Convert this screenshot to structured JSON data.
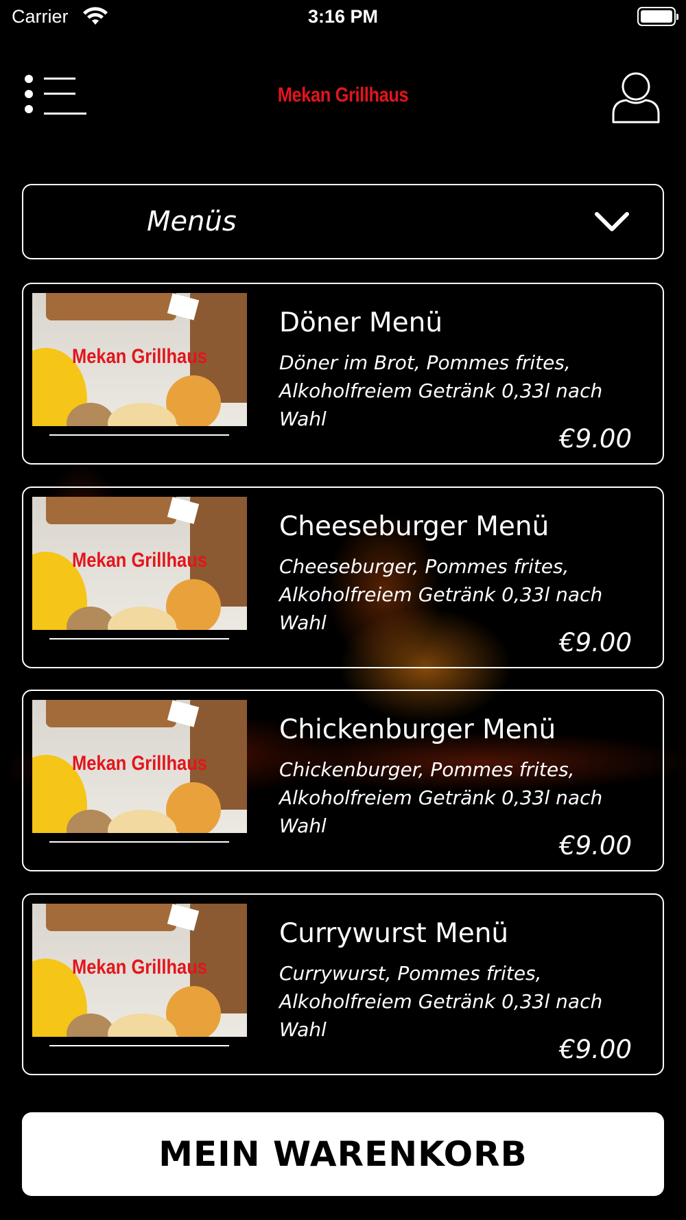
{
  "status_bar": {
    "carrier": "Carrier",
    "time": "3:16 PM"
  },
  "header": {
    "title": "Mekan Grillhaus"
  },
  "category": {
    "selected": "Menüs"
  },
  "items": [
    {
      "thumb_brand": "Mekan Grillhaus",
      "title": "Döner Menü",
      "description": "Döner im Brot, Pommes frites,\nAlkoholfreiem Getränk 0,33l nach Wahl",
      "price": "€9.00"
    },
    {
      "thumb_brand": "Mekan Grillhaus",
      "title": "Cheeseburger Menü",
      "description": "Cheeseburger, Pommes frites,\nAlkoholfreiem Getränk 0,33l nach Wahl",
      "price": "€9.00"
    },
    {
      "thumb_brand": "Mekan Grillhaus",
      "title": "Chickenburger Menü",
      "description": "Chickenburger, Pommes frites,\nAlkoholfreiem Getränk 0,33l nach Wahl",
      "price": "€9.00"
    },
    {
      "thumb_brand": "Mekan Grillhaus",
      "title": "Currywurst Menü",
      "description": "Currywurst, Pommes frites,\nAlkoholfreiem Getränk 0,33l nach Wahl",
      "price": "€9.00"
    }
  ],
  "cart": {
    "label": "MEIN WARENKORB"
  },
  "colors": {
    "brand_red": "#e3151c",
    "background": "#000000",
    "foreground": "#ffffff"
  },
  "icons": [
    "wifi-icon",
    "battery-icon",
    "menu-icon",
    "user-icon",
    "chevron-down-icon"
  ]
}
